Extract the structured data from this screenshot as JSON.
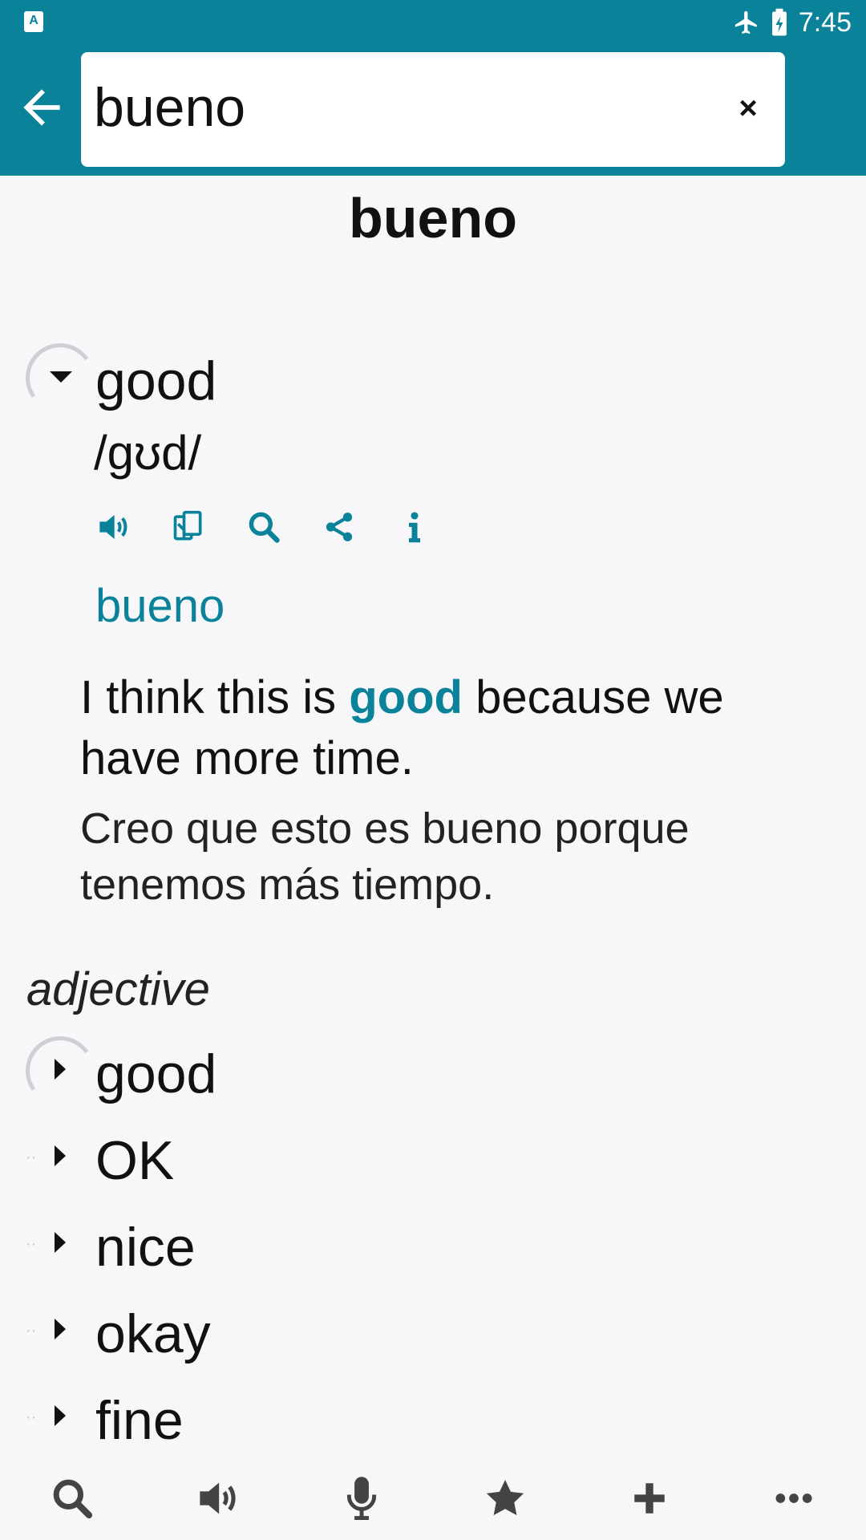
{
  "status_bar": {
    "app_icon_letter": "A",
    "time": "7:45",
    "icons": [
      "airplane-mode-icon",
      "battery-charging-icon"
    ]
  },
  "header": {
    "back_icon": "arrow-left-icon",
    "search": {
      "value": "bueno",
      "clear_label": "×"
    }
  },
  "headword": "bueno",
  "entry": {
    "word": "good",
    "phonetic": "/gʊd/",
    "actions": [
      "speaker-icon",
      "copy-icon",
      "search-icon",
      "share-icon",
      "info-icon"
    ],
    "translation": "bueno",
    "example": {
      "en_before": "I think this is ",
      "en_highlight": "good",
      "en_after": " because we have more time.",
      "es": "Creo que esto es bueno porque tenemos más tiempo."
    }
  },
  "part_of_speech": "adjective",
  "senses": [
    "good",
    "OK",
    "nice",
    "okay",
    "fine"
  ],
  "bottom_bar": [
    "search-icon",
    "speaker-icon",
    "microphone-icon",
    "star-icon",
    "plus-icon",
    "more-icon"
  ],
  "colors": {
    "accent": "#0a8299",
    "background": "#f7f7fa"
  }
}
